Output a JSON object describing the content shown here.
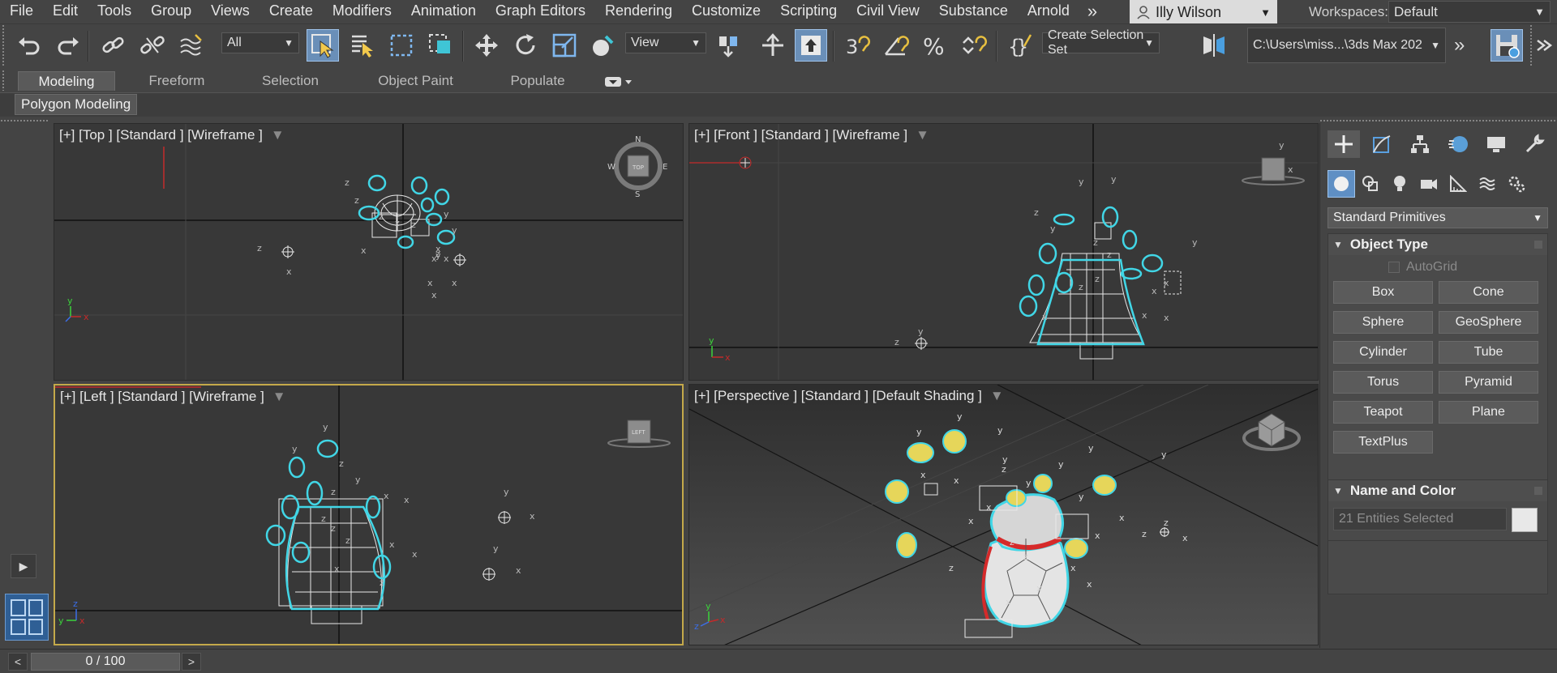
{
  "menu": {
    "items": [
      "File",
      "Edit",
      "Tools",
      "Group",
      "Views",
      "Create",
      "Modifiers",
      "Animation",
      "Graph Editors",
      "Rendering",
      "Customize",
      "Scripting",
      "Civil View",
      "Substance",
      "Arnold"
    ],
    "more": "»"
  },
  "user": {
    "name": "Illy Wilson"
  },
  "workspaces": {
    "label": "Workspaces:",
    "value": "Default"
  },
  "toolbar": {
    "filter_value": "All",
    "coord_value": "View",
    "selection_set": "Create Selection Set",
    "project_path": "C:\\Users\\miss...\\3ds Max 202",
    "more": "»",
    "accent": "#6a8fb8"
  },
  "ribbon": {
    "tabs": [
      "Modeling",
      "Freeform",
      "Selection",
      "Object Paint",
      "Populate"
    ],
    "active_tab": "Modeling",
    "panel_label": "Polygon Modeling"
  },
  "viewports": {
    "top": {
      "label": "[+] [Top ] [Standard ] [Wireframe ]"
    },
    "front": {
      "label": "[+] [Front ] [Standard ] [Wireframe ]"
    },
    "left": {
      "label": "[+] [Left ] [Standard ] [Wireframe ]"
    },
    "perspective": {
      "label": "[+] [Perspective ] [Standard ] [Default Shading ]"
    },
    "active_border": "#c4a94a",
    "selection_color": "#41d6e6",
    "viewcube": {
      "top": "TOP",
      "left": "LEFT",
      "compass": [
        "N",
        "E",
        "S",
        "W"
      ]
    },
    "axis_labels": {
      "x": "x",
      "y": "y",
      "z": "z"
    }
  },
  "command_panel": {
    "category": "Standard Primitives",
    "object_type": {
      "title": "Object Type",
      "autogrid": "AutoGrid",
      "buttons": [
        "Box",
        "Cone",
        "Sphere",
        "GeoSphere",
        "Cylinder",
        "Tube",
        "Torus",
        "Pyramid",
        "Teapot",
        "Plane",
        "TextPlus"
      ]
    },
    "name_and_color": {
      "title": "Name and Color",
      "field_value": "21 Entities Selected",
      "swatch": "#e8e8e8"
    }
  },
  "timeline": {
    "prev": "<",
    "position": "0 / 100",
    "next": ">"
  }
}
